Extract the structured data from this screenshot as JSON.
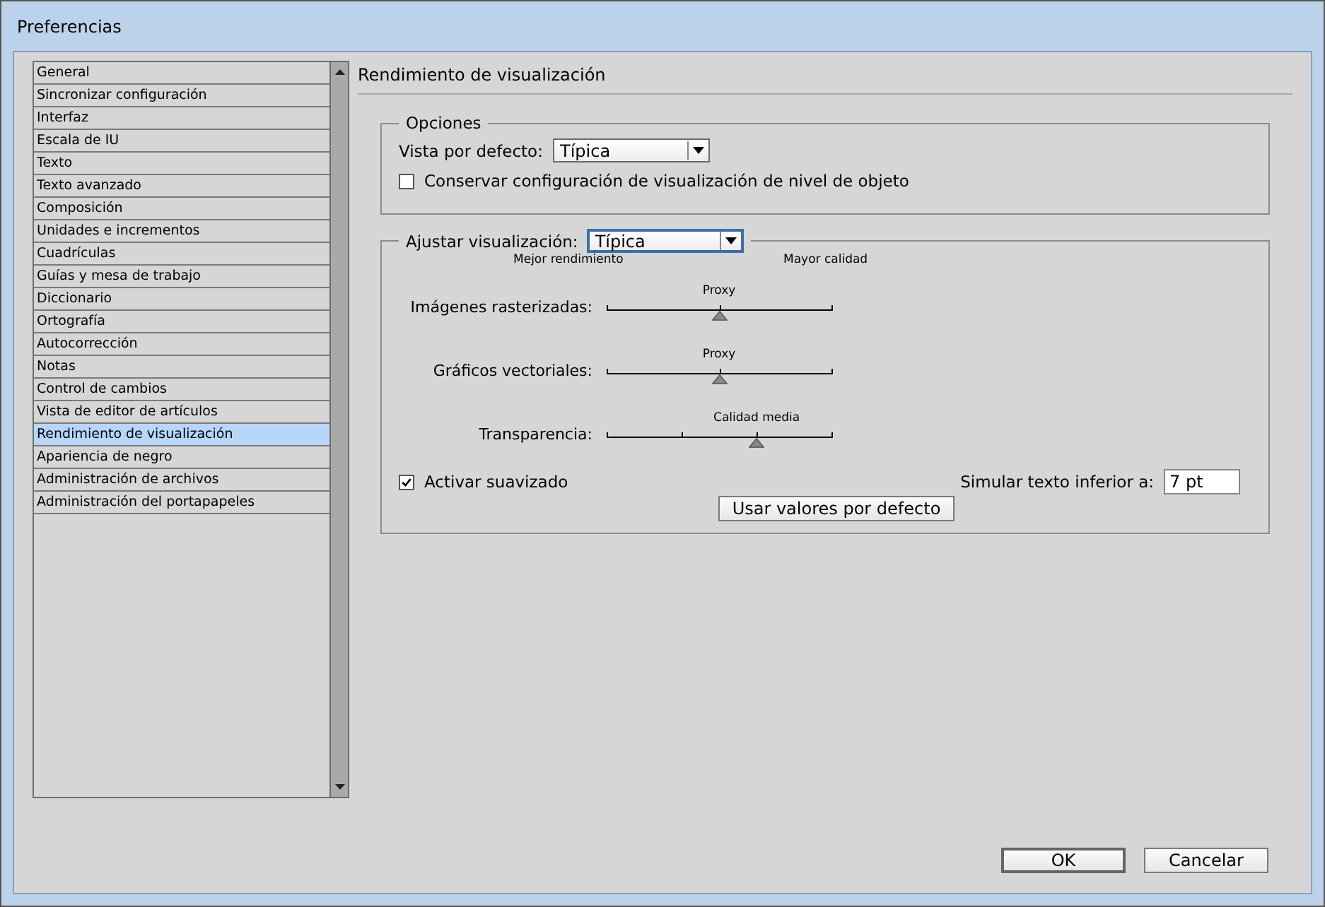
{
  "window": {
    "title": "Preferencias"
  },
  "sidebar": {
    "items": [
      {
        "label": "General",
        "selected": false
      },
      {
        "label": "Sincronizar configuración",
        "selected": false
      },
      {
        "label": "Interfaz",
        "selected": false
      },
      {
        "label": "Escala de IU",
        "selected": false
      },
      {
        "label": "Texto",
        "selected": false
      },
      {
        "label": "Texto avanzado",
        "selected": false
      },
      {
        "label": "Composición",
        "selected": false
      },
      {
        "label": "Unidades e incrementos",
        "selected": false
      },
      {
        "label": "Cuadrículas",
        "selected": false
      },
      {
        "label": "Guías y mesa de trabajo",
        "selected": false
      },
      {
        "label": "Diccionario",
        "selected": false
      },
      {
        "label": "Ortografía",
        "selected": false
      },
      {
        "label": "Autocorrección",
        "selected": false
      },
      {
        "label": "Notas",
        "selected": false
      },
      {
        "label": "Control de cambios",
        "selected": false
      },
      {
        "label": "Vista de editor de artículos",
        "selected": false
      },
      {
        "label": "Rendimiento de visualización",
        "selected": true
      },
      {
        "label": "Apariencia de negro",
        "selected": false
      },
      {
        "label": "Administración de archivos",
        "selected": false
      },
      {
        "label": "Administración del portapapeles",
        "selected": false
      }
    ]
  },
  "panel": {
    "title": "Rendimiento de visualización",
    "options": {
      "title": "Opciones",
      "default_view_label": "Vista por defecto:",
      "default_view": "Típica",
      "preserve_label": "Conservar configuración de visualización de nivel de objeto",
      "preserve_checked": false
    },
    "adjust": {
      "label": "Ajustar visualización:",
      "value": "Típica",
      "left_label": "Mejor rendimiento",
      "right_label": "Mayor calidad",
      "sliders": [
        {
          "label": "Imágenes rasterizadas:",
          "reading": "Proxy",
          "level": 0.5,
          "kind": "three-stop"
        },
        {
          "label": "Gráficos vectoriales:",
          "reading": "Proxy",
          "level": 0.5,
          "kind": "three-stop"
        },
        {
          "label": "Transparencia:",
          "reading": "Calidad media",
          "level": 0.667,
          "kind": "four-stop"
        }
      ],
      "antialias_label": "Activar suavizado",
      "antialias_checked": true,
      "greek_label": "Simular texto inferior a:",
      "greek_value": "7 pt",
      "defaults_button": "Usar valores por defecto"
    }
  },
  "buttons": [
    "OK",
    "Cancelar"
  ]
}
